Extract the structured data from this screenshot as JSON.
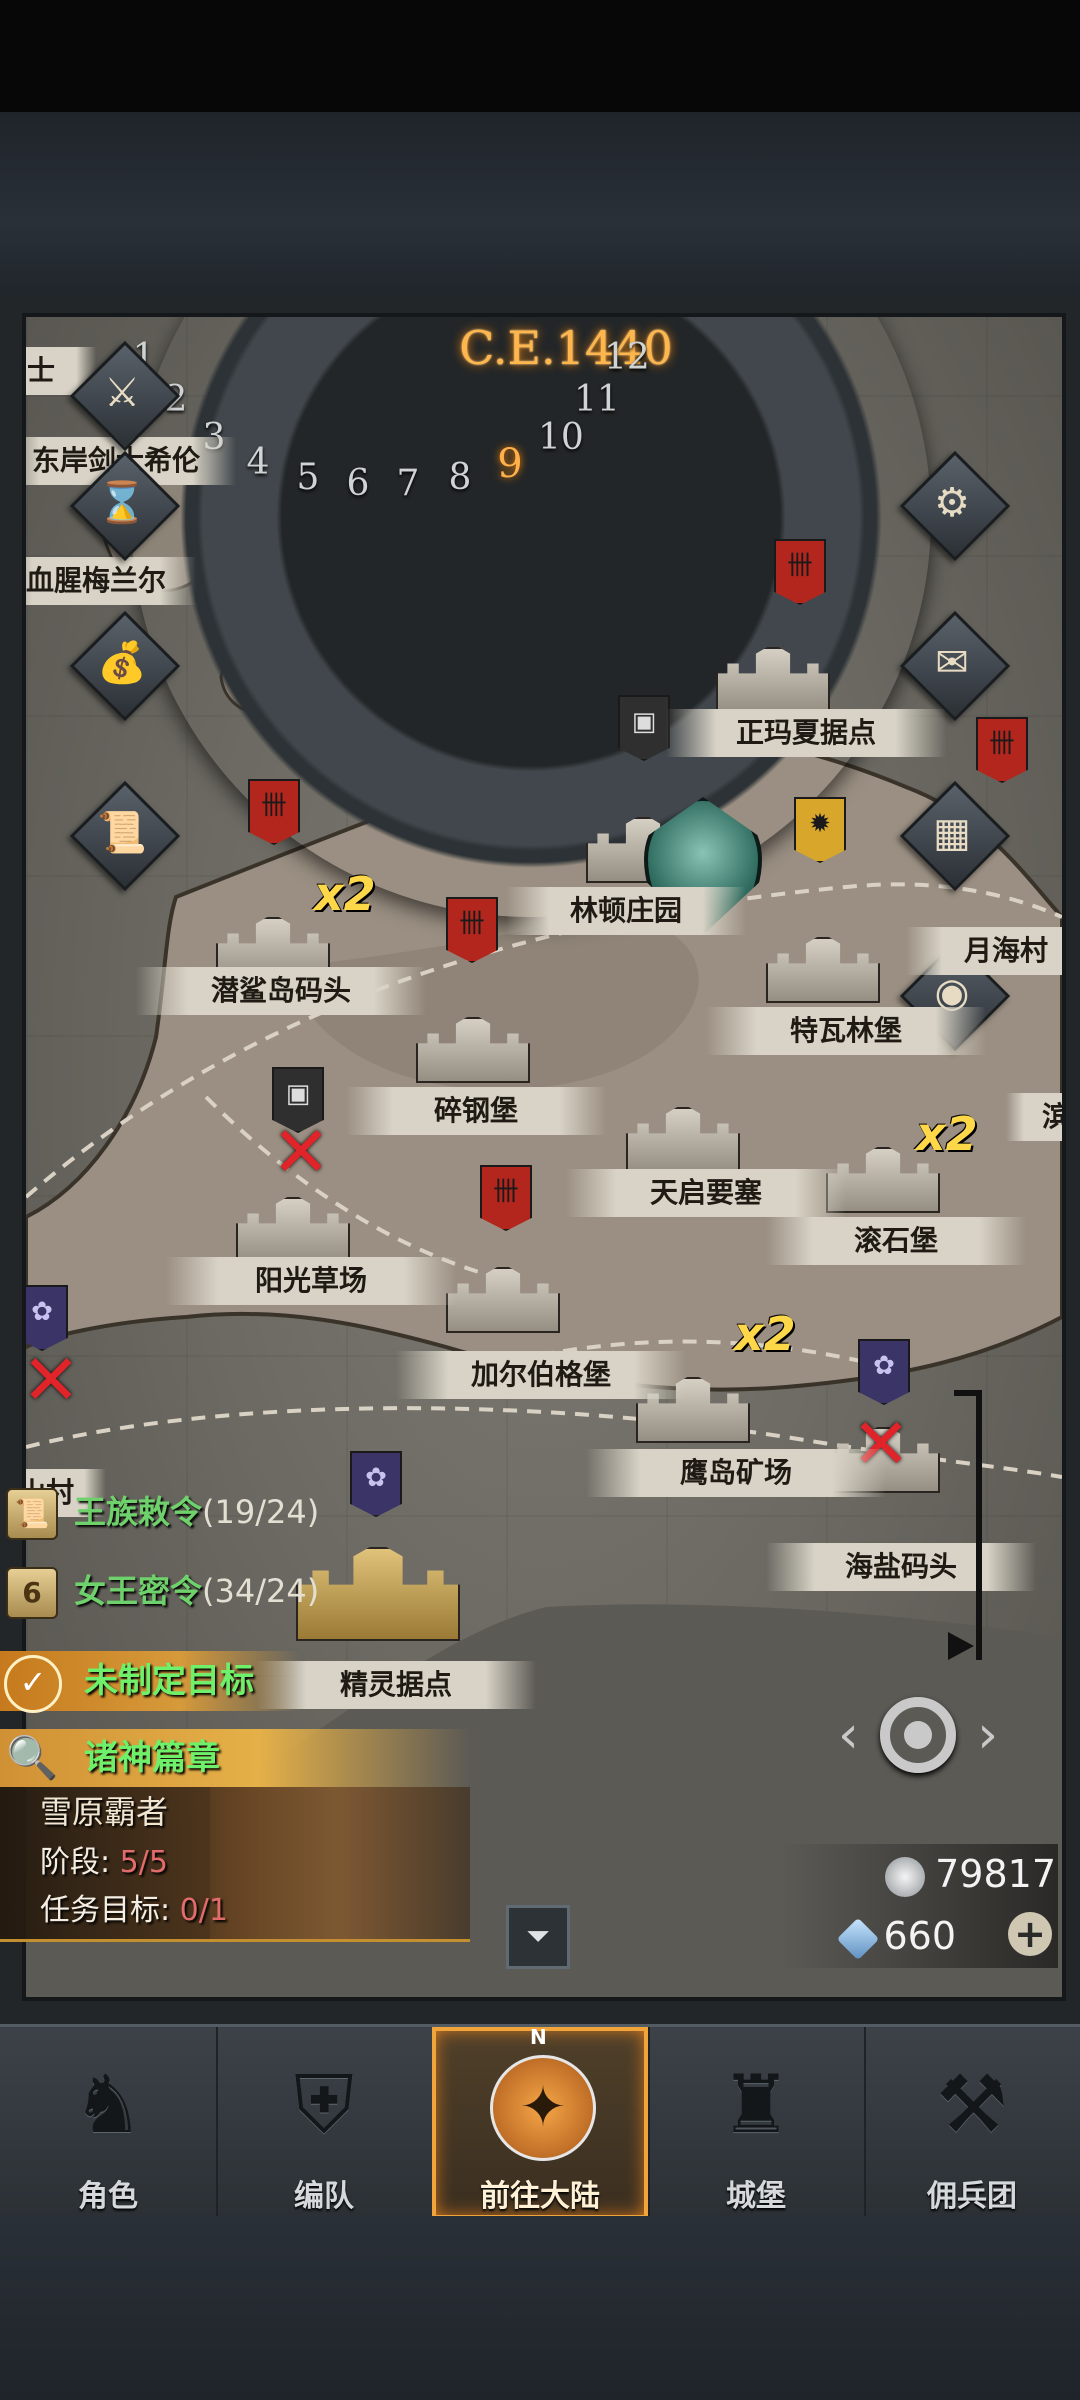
{
  "era": "C.E.1440",
  "months": [
    "1",
    "2",
    "3",
    "4",
    "5",
    "6",
    "7",
    "8",
    "9",
    "10",
    "11",
    "12"
  ],
  "active_month": "9",
  "left_clipped_labels": [
    "士",
    "东岸剑士希伦",
    "血腥梅兰尔"
  ],
  "locations": {
    "zhengma": "正玛夏据点",
    "linton": "林顿庄园",
    "yuehai": "月海村",
    "qiansha": "潜鲨岛码头",
    "tewalin": "特瓦林堡",
    "suigang": "碎钢堡",
    "tianqi": "天启要塞",
    "binhai": "滨",
    "yangguang": "阳光草场",
    "gunshi": "滚石堡",
    "jiaerbo": "加尔伯格堡",
    "yingdao": "鹰岛矿场",
    "haiyan": "海盐码头",
    "jingling": "精灵据点",
    "leftcut": "山村"
  },
  "multiplier": "x2",
  "quests": {
    "royal_decree": {
      "label": "王族敕令",
      "count": "(19/24)"
    },
    "queen_order": {
      "label": "女王密令",
      "count": "(34/24)",
      "badge": "6"
    }
  },
  "goal_label": "未制定目标",
  "chapter": {
    "title": "诸神篇章",
    "subtitle": "雪原霸者",
    "stage_label": "阶段:",
    "stage_value": "5/5",
    "target_label": "任务目标:",
    "target_value": "0/1"
  },
  "resources": {
    "silver": "79817",
    "crystal": "660"
  },
  "nav": [
    {
      "label": "角色"
    },
    {
      "label": "编队"
    },
    {
      "label": "前往大陆"
    },
    {
      "label": "城堡"
    },
    {
      "label": "佣兵团"
    }
  ],
  "compass_n": "N",
  "colors": {
    "accent": "#f0a43a",
    "quest_green": "#6fd16b",
    "era_glow": "#ffb74d",
    "value_red": "#e26b6b"
  }
}
